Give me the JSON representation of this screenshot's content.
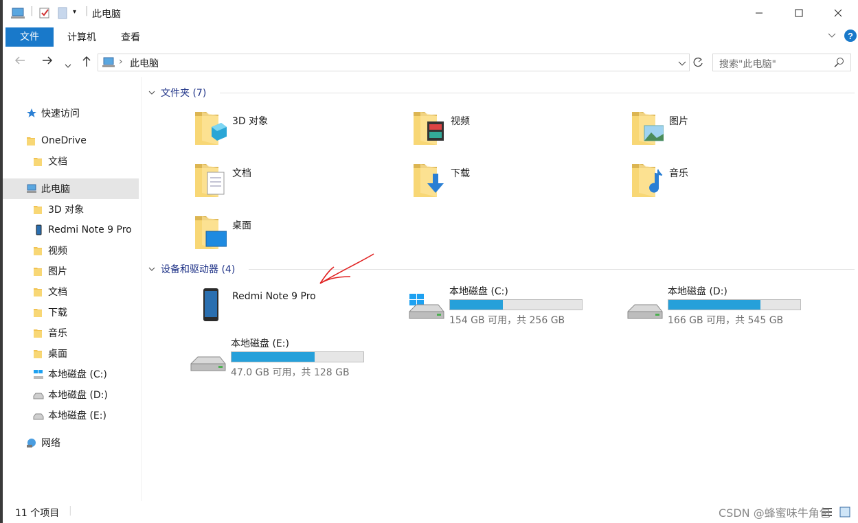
{
  "window": {
    "title": "此电脑"
  },
  "ribbon": {
    "tabs": [
      "文件",
      "计算机",
      "查看"
    ]
  },
  "address": {
    "path": "此电脑",
    "search_placeholder": "搜索\"此电脑\""
  },
  "sidebar": {
    "items": [
      {
        "label": "快速访问",
        "icon": "star-icon"
      },
      {
        "label": "OneDrive",
        "icon": "folder-icon"
      },
      {
        "label": "文档",
        "icon": "folder-icon"
      },
      {
        "label": "此电脑",
        "icon": "computer-icon"
      },
      {
        "label": "3D 对象",
        "icon": "folder-3d-icon"
      },
      {
        "label": "Redmi Note 9 Pro",
        "icon": "phone-icon"
      },
      {
        "label": "视频",
        "icon": "video-folder-icon"
      },
      {
        "label": "图片",
        "icon": "pictures-folder-icon"
      },
      {
        "label": "文档",
        "icon": "documents-folder-icon"
      },
      {
        "label": "下载",
        "icon": "downloads-folder-icon"
      },
      {
        "label": "音乐",
        "icon": "music-folder-icon"
      },
      {
        "label": "桌面",
        "icon": "desktop-folder-icon"
      },
      {
        "label": "本地磁盘 (C:)",
        "icon": "windows-drive-icon"
      },
      {
        "label": "本地磁盘 (D:)",
        "icon": "drive-icon"
      },
      {
        "label": "本地磁盘 (E:)",
        "icon": "drive-icon"
      },
      {
        "label": "网络",
        "icon": "network-icon"
      }
    ]
  },
  "folders": {
    "header": "文件夹 (7)",
    "items": [
      "3D 对象",
      "视频",
      "图片",
      "文档",
      "下载",
      "音乐",
      "桌面"
    ]
  },
  "devices": {
    "header": "设备和驱动器 (4)",
    "phone": "Redmi Note 9 Pro",
    "drives": [
      {
        "name": "本地磁盘 (C:)",
        "free": "154 GB 可用，共 256 GB",
        "used_fraction": 0.4
      },
      {
        "name": "本地磁盘 (D:)",
        "free": "166 GB 可用，共 545 GB",
        "used_fraction": 0.7
      },
      {
        "name": "本地磁盘 (E:)",
        "free": "47.0 GB 可用，共 128 GB",
        "used_fraction": 0.63
      }
    ]
  },
  "status": {
    "count": "11 个项目"
  },
  "watermark": "CSDN @蜂蜜味牛角包",
  "colors": {
    "accent": "#1979ca",
    "bar_fill": "#26a0da",
    "group_header": "#1e3287",
    "annotation": "#e02020"
  }
}
